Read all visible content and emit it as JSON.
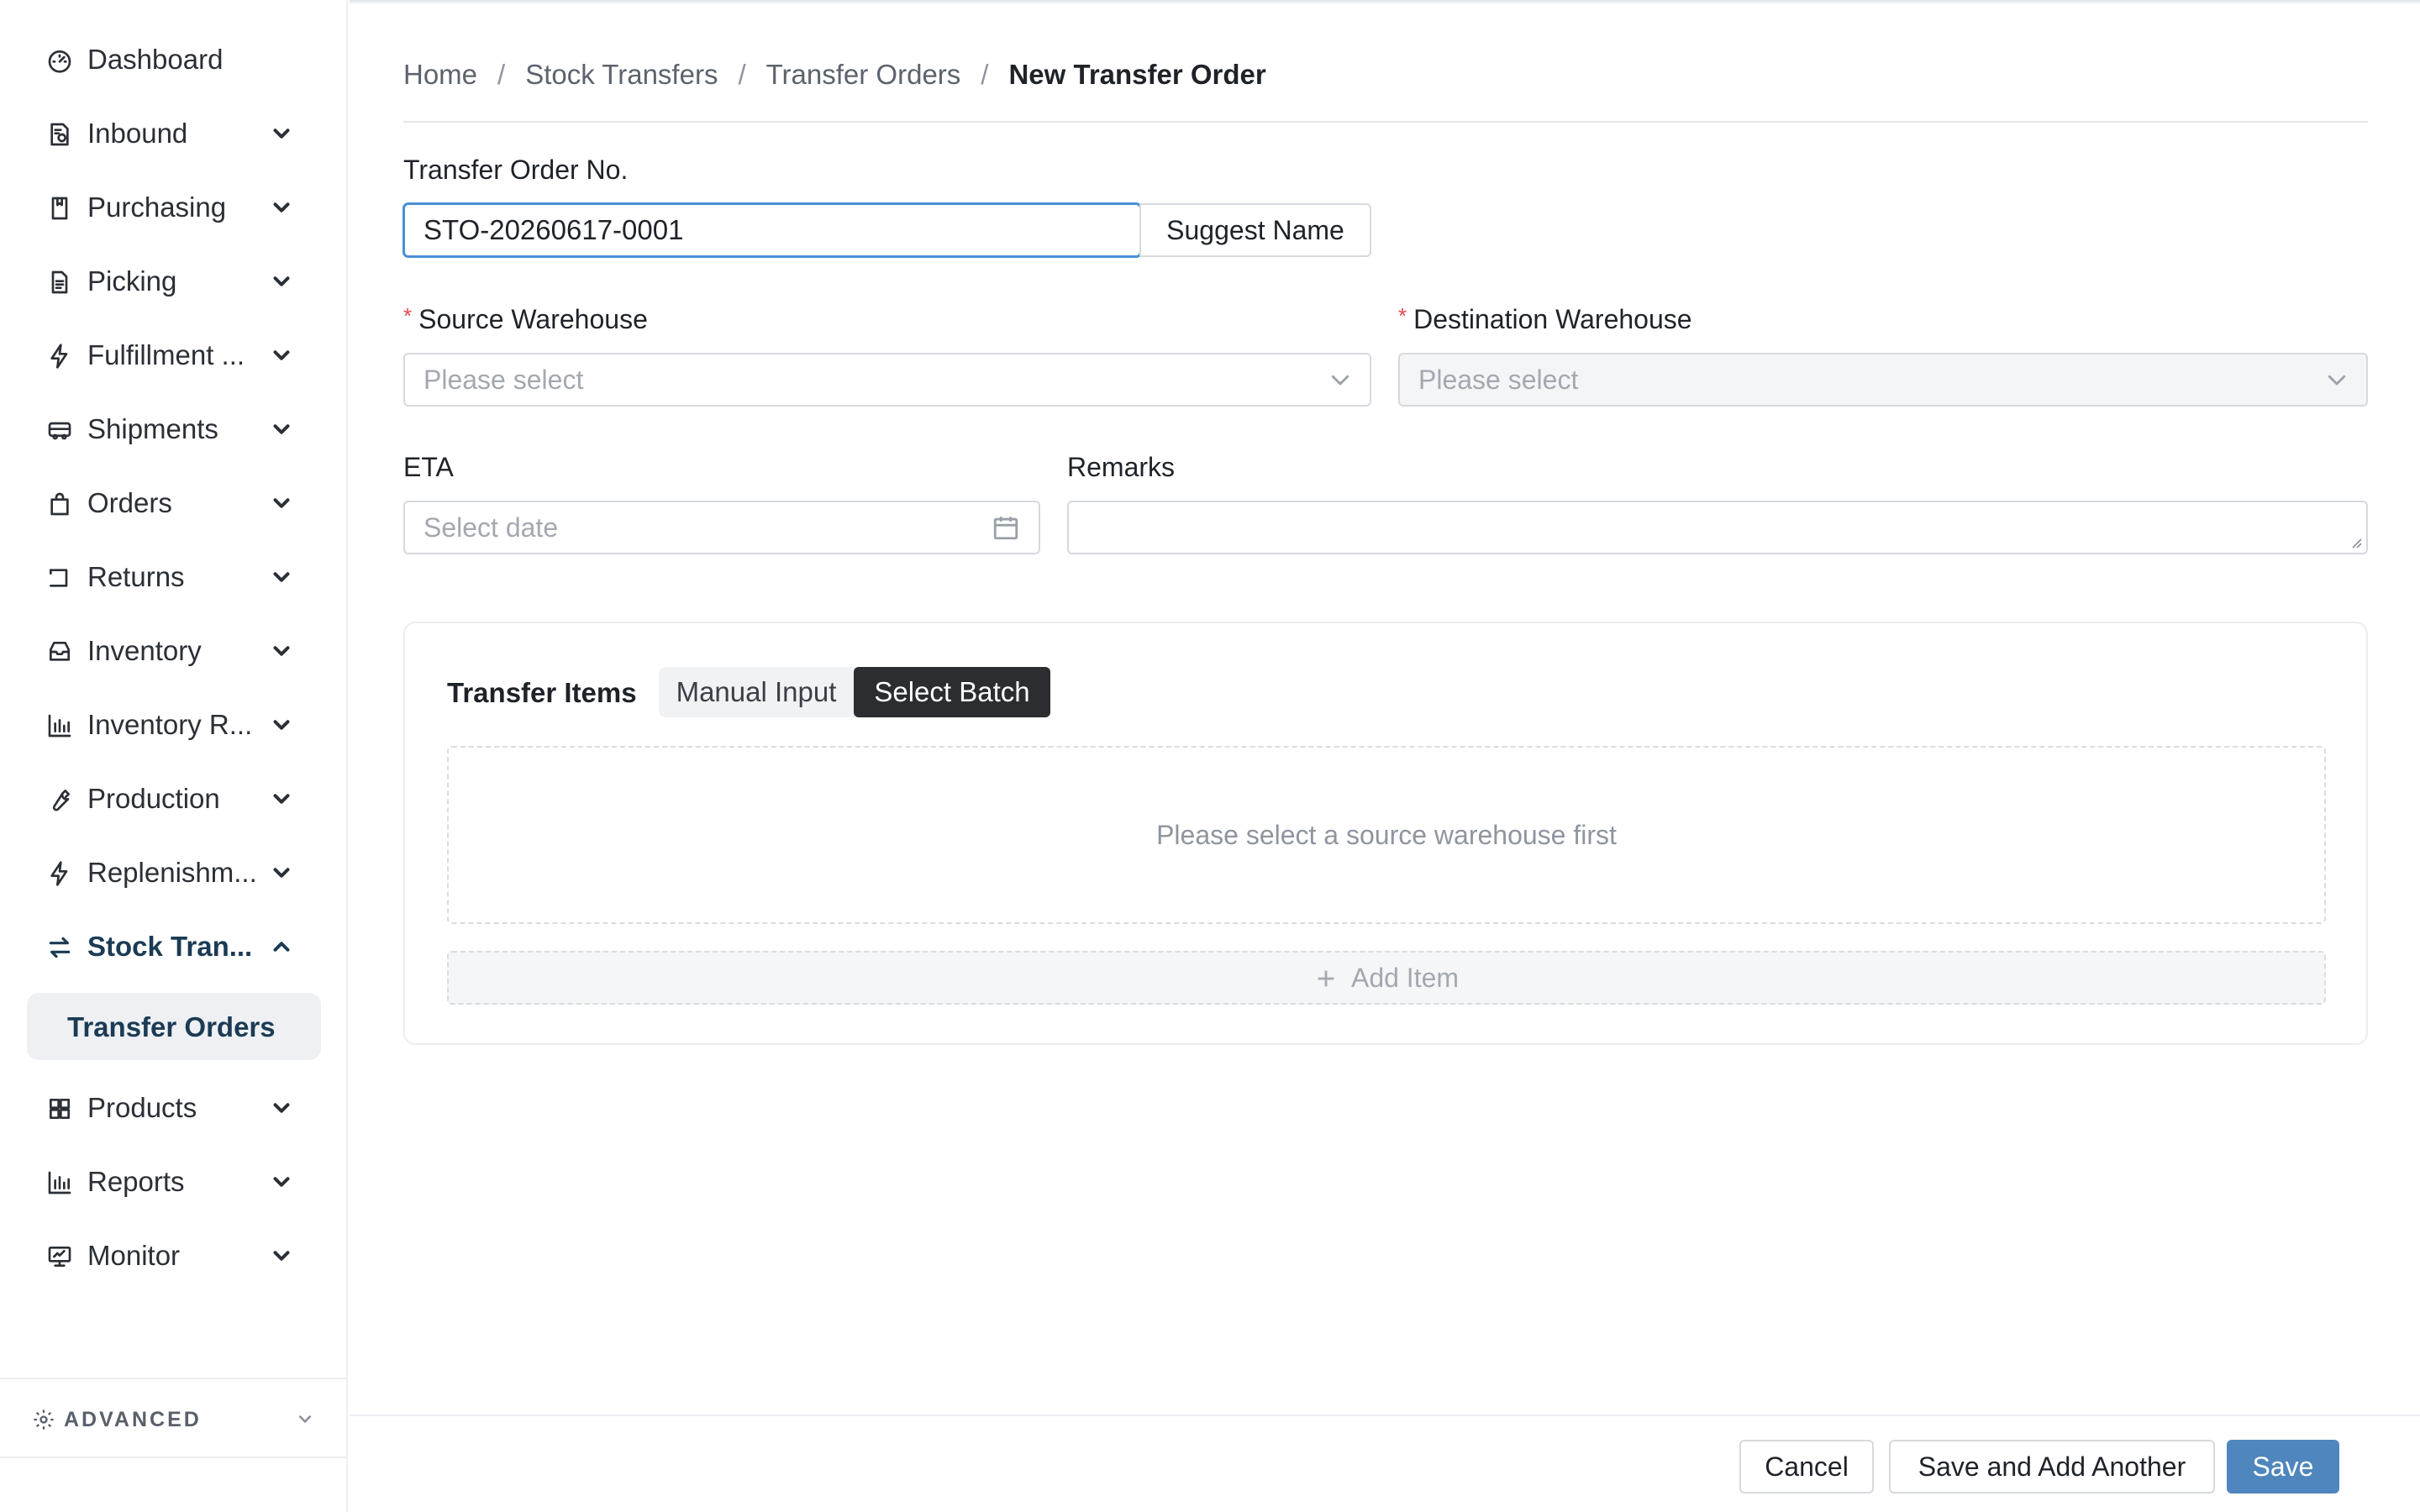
{
  "sidebar": {
    "items": [
      {
        "label": "Dashboard",
        "icon": "dashboard-icon"
      },
      {
        "label": "Inbound",
        "icon": "inbound-icon"
      },
      {
        "label": "Purchasing",
        "icon": "purchasing-icon"
      },
      {
        "label": "Picking",
        "icon": "picking-icon"
      },
      {
        "label": "Fulfillment ...",
        "icon": "bolt-icon"
      },
      {
        "label": "Shipments",
        "icon": "truck-icon"
      },
      {
        "label": "Orders",
        "icon": "bag-icon"
      },
      {
        "label": "Returns",
        "icon": "return-icon"
      },
      {
        "label": "Inventory",
        "icon": "inbox-icon"
      },
      {
        "label": "Inventory R...",
        "icon": "bar-chart-icon"
      },
      {
        "label": "Production",
        "icon": "wrench-icon"
      },
      {
        "label": "Replenishm...",
        "icon": "bolt-icon"
      },
      {
        "label": "Stock Tran...",
        "icon": "transfer-icon"
      },
      {
        "label": "Products",
        "icon": "grid-icon"
      },
      {
        "label": "Reports",
        "icon": "bar-chart-icon"
      },
      {
        "label": "Monitor",
        "icon": "monitor-icon"
      }
    ],
    "active_sub_item": "Transfer Orders",
    "advanced_label": "ADVANCED"
  },
  "breadcrumb": {
    "items": [
      "Home",
      "Stock Transfers",
      "Transfer Orders"
    ],
    "current": "New Transfer Order",
    "separator": "/"
  },
  "form": {
    "order_no": {
      "label": "Transfer Order No.",
      "value": "STO-20260617-0001",
      "suggest_label": "Suggest Name"
    },
    "source_warehouse": {
      "label": "Source Warehouse",
      "required_mark": "*",
      "placeholder": "Please select"
    },
    "destination_warehouse": {
      "label": "Destination Warehouse",
      "required_mark": "*",
      "placeholder": "Please select"
    },
    "eta": {
      "label": "ETA",
      "placeholder": "Select date"
    },
    "remarks": {
      "label": "Remarks",
      "value": ""
    }
  },
  "transfer_items": {
    "title": "Transfer Items",
    "tabs": [
      "Manual Input",
      "Select Batch"
    ],
    "active_tab": "Select Batch",
    "empty_text": "Please select a source warehouse first",
    "add_item_label": "Add Item"
  },
  "footer": {
    "cancel_label": "Cancel",
    "save_add_label": "Save and Add Another",
    "save_label": "Save"
  },
  "colors": {
    "primary": "#4f86bd",
    "active_nav": "#1b3b55",
    "required": "#e5484d",
    "segment_active": "#2b2d31"
  }
}
